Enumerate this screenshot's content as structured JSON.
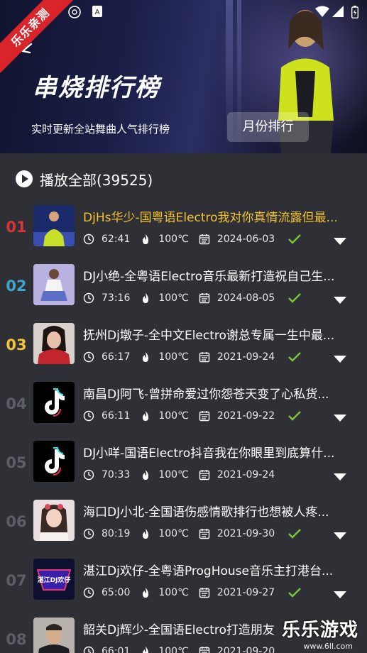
{
  "header": {
    "title": "串烧排行榜",
    "subtitle": "实时更新全站舞曲人气排行榜",
    "month_button": "月份排行",
    "ribbon": "乐乐亲测"
  },
  "play_all": {
    "label": "播放全部(39525)"
  },
  "colors": {
    "rank_1": "#d8343a",
    "rank_2": "#3fa6c9",
    "rank_3": "#f0c43b",
    "rank_other": "#5c5f68",
    "highlight_title": "#f2c230",
    "check": "#7bc63b"
  },
  "tracks": [
    {
      "rank": "01",
      "title": "DjHs华少-国粤语Electro我对你真情流露但最...",
      "duration": "62:41",
      "heat": "100℃",
      "date": "2024-06-03",
      "checked": true,
      "highlight": true
    },
    {
      "rank": "02",
      "title": "DJ小绝-全粤语Electro音乐最新打造祝自己生...",
      "duration": "73:16",
      "heat": "100℃",
      "date": "2024-08-05",
      "checked": true
    },
    {
      "rank": "03",
      "title": "抚州Dj墩子-全中文Electro谢总专属一生中最...",
      "duration": "66:17",
      "heat": "100℃",
      "date": "2021-09-24",
      "checked": true
    },
    {
      "rank": "04",
      "title": "南昌DJ阿飞-曾拼命爱过你怨苍天变了心私货...",
      "duration": "66:11",
      "heat": "100℃",
      "date": "2021-09-22",
      "checked": true
    },
    {
      "rank": "05",
      "title": "DJ小咩-国语Electro抖音我在你眼里到底算什...",
      "duration": "70:33",
      "heat": "100℃",
      "date": "2021-09-24",
      "checked": false
    },
    {
      "rank": "06",
      "title": "海口DJ小北-全国语伤感情歌排行也想被人疼...",
      "duration": "80:19",
      "heat": "100℃",
      "date": "2021-09-30",
      "checked": true
    },
    {
      "rank": "07",
      "title": "湛江Dj欢仔-全粤语ProgHouse音乐主打港台...",
      "duration": "65:00",
      "heat": "100℃",
      "date": "2021-09-27",
      "checked": true
    },
    {
      "rank": "08",
      "title": "韶关Dj辉少-全国语Electro打造朋友",
      "duration": "66:01",
      "heat": "100℃",
      "date": "2021-09-20",
      "checked": false
    }
  ],
  "thumb_text": {
    "t7": "湛江DJ欢仔"
  },
  "watermark": {
    "brand": "乐乐游戏",
    "url": "www.6ll.com"
  }
}
